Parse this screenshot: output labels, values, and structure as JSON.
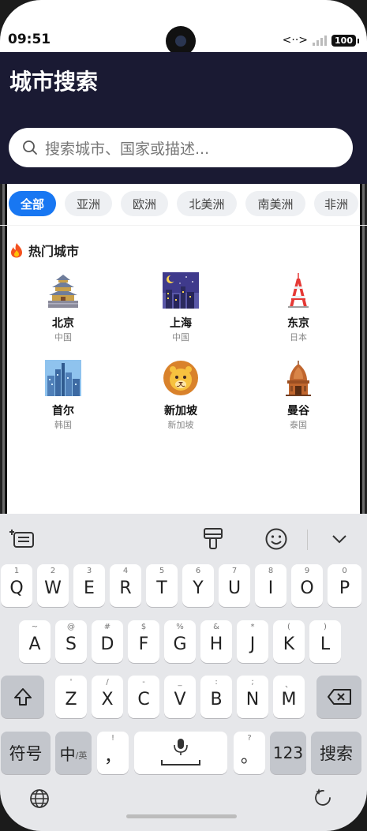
{
  "status": {
    "time": "09:51",
    "battery": "100"
  },
  "header": {
    "title": "城市搜索"
  },
  "search": {
    "placeholder": "搜索城市、国家或描述..."
  },
  "filters": [
    "全部",
    "亚洲",
    "欧洲",
    "北美洲",
    "南美洲",
    "非洲"
  ],
  "section": {
    "title": "热门城市",
    "icon": "fire-icon"
  },
  "cities": [
    {
      "name": "北京",
      "country": "中国",
      "icon": "palace-icon"
    },
    {
      "name": "上海",
      "country": "中国",
      "icon": "night-city-icon"
    },
    {
      "name": "东京",
      "country": "日本",
      "icon": "tokyo-tower-icon"
    },
    {
      "name": "首尔",
      "country": "韩国",
      "icon": "skyline-icon"
    },
    {
      "name": "新加坡",
      "country": "新加坡",
      "icon": "lion-icon"
    },
    {
      "name": "曼谷",
      "country": "泰国",
      "icon": "temple-icon"
    }
  ],
  "keyboard": {
    "row1": [
      {
        "k": "Q",
        "n": "1"
      },
      {
        "k": "W",
        "n": "2"
      },
      {
        "k": "E",
        "n": "3"
      },
      {
        "k": "R",
        "n": "4"
      },
      {
        "k": "T",
        "n": "5"
      },
      {
        "k": "Y",
        "n": "6"
      },
      {
        "k": "U",
        "n": "7"
      },
      {
        "k": "I",
        "n": "8"
      },
      {
        "k": "O",
        "n": "9"
      },
      {
        "k": "P",
        "n": "0"
      }
    ],
    "row2": [
      {
        "k": "A",
        "n": "~"
      },
      {
        "k": "S",
        "n": "@"
      },
      {
        "k": "D",
        "n": "#"
      },
      {
        "k": "F",
        "n": "$"
      },
      {
        "k": "G",
        "n": "%"
      },
      {
        "k": "H",
        "n": "&"
      },
      {
        "k": "J",
        "n": "*"
      },
      {
        "k": "K",
        "n": "("
      },
      {
        "k": "L",
        "n": ")"
      }
    ],
    "row3": [
      {
        "k": "Z",
        "n": "'"
      },
      {
        "k": "X",
        "n": "/"
      },
      {
        "k": "C",
        "n": "-"
      },
      {
        "k": "V",
        "n": "_"
      },
      {
        "k": "B",
        "n": ":"
      },
      {
        "k": "N",
        "n": ";"
      },
      {
        "k": "M",
        "n": "、"
      }
    ],
    "symbols": "符号",
    "lang_main": "中",
    "lang_sub": "/英",
    "comma": "，",
    "comma_sub": "!",
    "period": "。",
    "period_sub": "?",
    "num": "123",
    "action": "搜索"
  }
}
